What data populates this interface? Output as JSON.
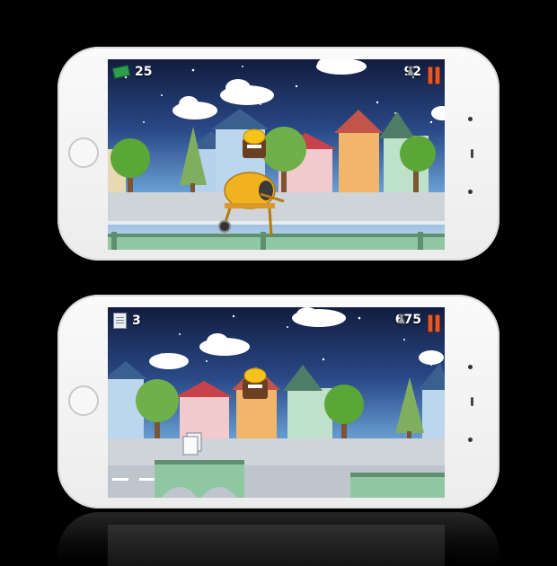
{
  "top_screen": {
    "score_label": "25",
    "score_icon": "cash-icon",
    "coins_label": "92",
    "coins_icon": "money-bag-icon",
    "pause_icon": "pause-icon",
    "vehicle": "cement-mixer",
    "character": "construction-worker-hardhat"
  },
  "bottom_screen": {
    "score_label": "3",
    "score_icon": "paper-stack-icon",
    "coins_label": "675",
    "coins_icon": "money-bag-icon",
    "pause_icon": "pause-icon",
    "pickup": "paper-stack",
    "character": "construction-worker-hardhat"
  },
  "colors": {
    "sky_top": "#121c3f",
    "sky_bottom": "#c8dcec",
    "pause": "#e05a2b",
    "mixer": "#f0b21e",
    "bridge": "#8fc7a3"
  }
}
